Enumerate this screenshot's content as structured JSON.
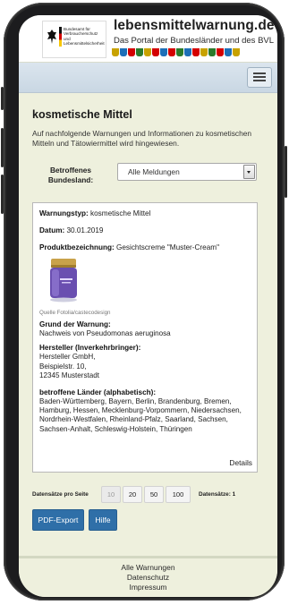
{
  "header": {
    "site_title": "lebensmittelwarnung.de",
    "site_subtitle": "Das Portal der Bundesländer und des BVL",
    "logo_text": "Bundesamt für Verbraucherschutz und Lebensmittelsicherheit",
    "crest_colors": [
      "#c8a200",
      "#1d6fb8",
      "#d40000",
      "#2b7a2b",
      "#c8a200",
      "#d40000",
      "#1d6fb8",
      "#d40000",
      "#2b7a2b",
      "#1d6fb8",
      "#d40000",
      "#c8a200",
      "#2b7a2b",
      "#d40000",
      "#1d6fb8",
      "#c8a200"
    ]
  },
  "navbar": {
    "menu_icon": "hamburger-menu-icon"
  },
  "main": {
    "title": "kosmetische Mittel",
    "intro": "Auf nachfolgende Warnungen und Informationen zu kosmetischen Mitteln und Tätowiermittel wird hingewiesen.",
    "filter": {
      "label": "Betroffenes Bundesland:",
      "selected": "Alle Meldungen"
    },
    "warning": {
      "type_label": "Warnungstyp:",
      "type_value": "kosmetische Mittel",
      "date_label": "Datum:",
      "date_value": "30.01.2019",
      "product_label": "Produktbezeichnung:",
      "product_value": "Gesichtscreme \"Muster-Cream\"",
      "image_caption": "Quelle Fotolia/castecodesign",
      "reason_label": "Grund der Warnung:",
      "reason_value": "Nachweis von Pseudomonas aeruginosa",
      "manufacturer_label": "Hersteller (Inverkehrbringer):",
      "manufacturer_line1": "Hersteller GmbH,",
      "manufacturer_line2": "Beispielstr. 10,",
      "manufacturer_line3": "12345 Musterstadt",
      "countries_label": "betroffene Länder (alphabetisch):",
      "countries_value": "Baden-Württemberg, Bayern, Berlin, Brandenburg, Bremen, Hamburg, Hessen, Mecklenburg-Vorpommern, Niedersachsen, Nordrhein-Westfalen, Rheinland-Pfalz, Saarland, Sachsen, Sachsen-Anhalt, Schleswig-Holstein, Thüringen",
      "details_link": "Details"
    },
    "pager": {
      "label": "Datensätze pro Seite",
      "options": [
        "10",
        "20",
        "50",
        "100"
      ],
      "count_text": "Datensätze: 1"
    },
    "actions": {
      "pdf_export": "PDF-Export",
      "help": "Hilfe"
    }
  },
  "footer": {
    "links": [
      "Alle Warnungen",
      "Datenschutz",
      "Impressum"
    ]
  }
}
